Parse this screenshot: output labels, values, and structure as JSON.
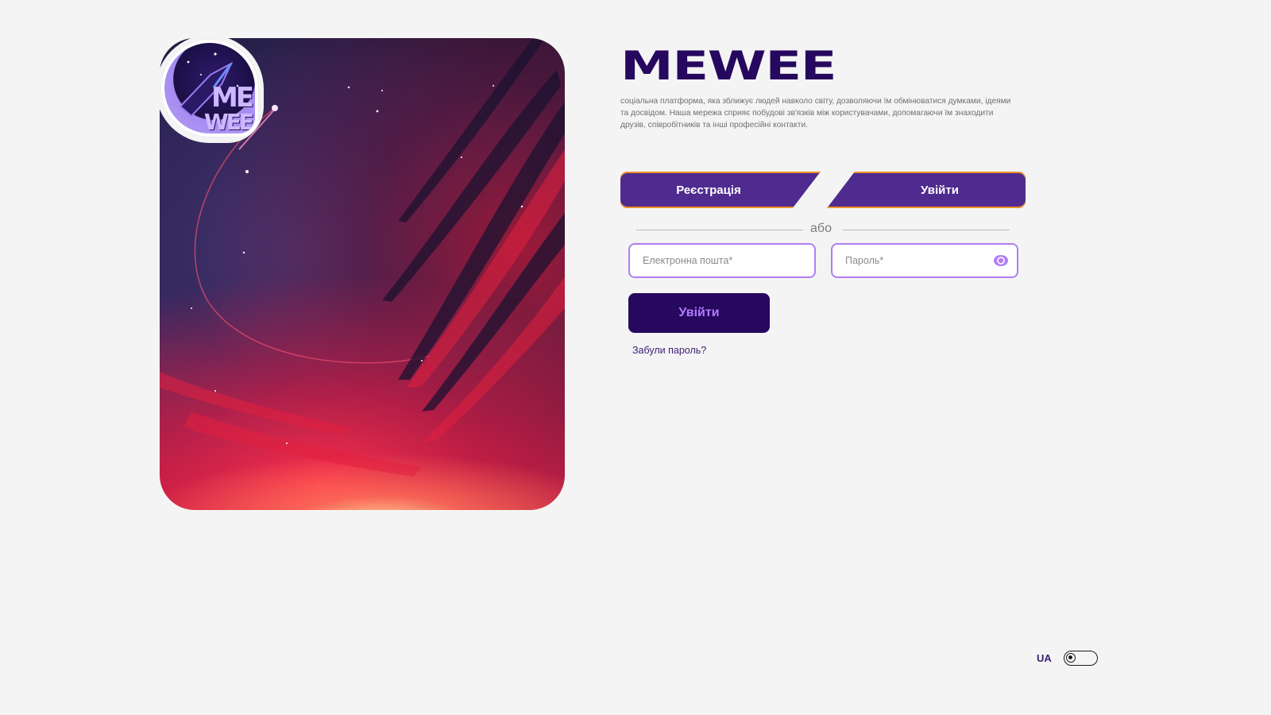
{
  "brand": {
    "name": "MEWEE",
    "tagline": "соціальна платформа, яка зближує людей навколо світу, дозволяючи їм обмінюватися думками, ідеями та досвідом. Наша мережа сприяє побудові зв'язків між користувачами, допомагаючи їм знаходити друзів, співробітників та інші професійні контакти.",
    "logo_text_line1": "ME",
    "logo_text_line2": "WEE"
  },
  "tabs": {
    "register_label": "Реєстрація",
    "login_label": "Увійти"
  },
  "divider_label": "або",
  "form": {
    "email_placeholder": "Електронна пошта*",
    "email_value": "",
    "password_placeholder": "Пароль*",
    "password_value": "",
    "submit_label": "Увійти",
    "forgot_label": "Забули пароль?"
  },
  "language": {
    "current": "UA"
  },
  "colors": {
    "brand_dark": "#26085e",
    "tab_purple": "#4f2a8f",
    "accent_orange": "#f0902a",
    "input_border": "#b07ef2",
    "submit_text": "#b27bff"
  },
  "icons": {
    "password_toggle": "eye-icon"
  }
}
